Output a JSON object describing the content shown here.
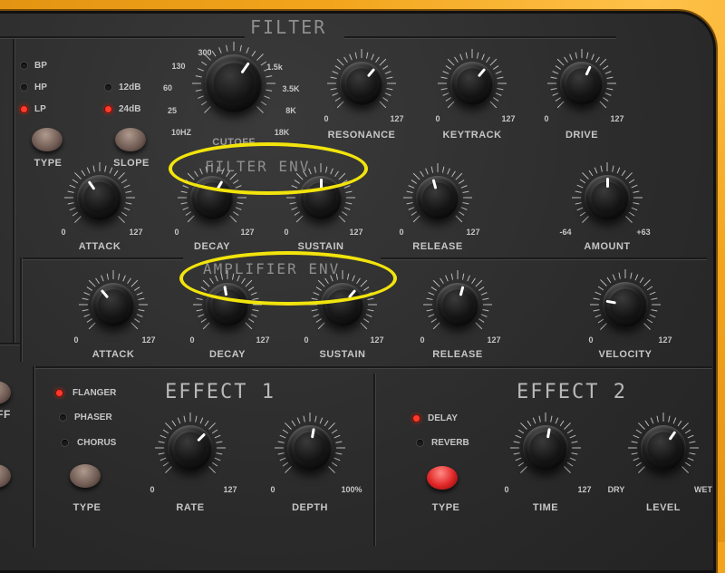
{
  "colors": {
    "accent_orange": "#f2a51c",
    "panel": "#2e2e2e",
    "led_on": "#ff3b2b",
    "highlight": "#f2e40c"
  },
  "sections": {
    "filter": "FILTER",
    "filter_env": "FILTER ENV",
    "amplifier_env": "AMPLIFIER ENV",
    "effect1": "EFFECT 1",
    "effect2": "EFFECT 2"
  },
  "filter": {
    "type_leds": [
      {
        "label": "BP",
        "on": false
      },
      {
        "label": "HP",
        "on": false
      },
      {
        "label": "LP",
        "on": true
      }
    ],
    "slope_leds": [
      {
        "label": "12dB",
        "on": false
      },
      {
        "label": "24dB",
        "on": true
      }
    ],
    "type_label": "TYPE",
    "slope_label": "SLOPE",
    "cutoff": {
      "label": "CUTOFF",
      "scale": [
        "10HZ",
        "25",
        "60",
        "130",
        "300",
        "1.5k",
        "3.5K",
        "8K",
        "18K"
      ]
    },
    "resonance": {
      "label": "RESONANCE",
      "min": "0",
      "max": "127"
    },
    "keytrack": {
      "label": "KEYTRACK",
      "min": "0",
      "max": "127"
    },
    "drive": {
      "label": "DRIVE",
      "min": "0",
      "max": "127"
    }
  },
  "filter_env": {
    "attack": {
      "label": "ATTACK",
      "min": "0",
      "max": "127"
    },
    "decay": {
      "label": "DECAY",
      "min": "0",
      "max": "127"
    },
    "sustain": {
      "label": "SUSTAIN",
      "min": "0",
      "max": "127"
    },
    "release": {
      "label": "RELEASE",
      "min": "0",
      "max": "127"
    },
    "amount": {
      "label": "AMOUNT",
      "min": "-64",
      "max": "+63"
    }
  },
  "amp_env": {
    "attack": {
      "label": "ATTACK",
      "min": "0",
      "max": "127"
    },
    "decay": {
      "label": "DECAY",
      "min": "0",
      "max": "127"
    },
    "sustain": {
      "label": "SUSTAIN",
      "min": "0",
      "max": "127"
    },
    "release": {
      "label": "RELEASE",
      "min": "0",
      "max": "127"
    },
    "velocity": {
      "label": "VELOCITY",
      "min": "0",
      "max": "127"
    }
  },
  "effect1": {
    "leds": [
      {
        "label": "FLANGER",
        "on": true
      },
      {
        "label": "PHASER",
        "on": false
      },
      {
        "label": "CHORUS",
        "on": false
      }
    ],
    "type_label": "TYPE",
    "rate": {
      "label": "RATE",
      "min": "0",
      "max": "127"
    },
    "depth": {
      "label": "DEPTH",
      "min": "0",
      "max": "100%"
    }
  },
  "effect2": {
    "leds": [
      {
        "label": "DELAY",
        "on": true
      },
      {
        "label": "REVERB",
        "on": false
      }
    ],
    "type_label": "TYPE",
    "time": {
      "label": "TIME",
      "min": "0",
      "max": "127"
    },
    "level": {
      "label": "LEVEL",
      "min": "DRY",
      "max": "WET"
    }
  },
  "left_edge": {
    "partial_label": "FF"
  }
}
